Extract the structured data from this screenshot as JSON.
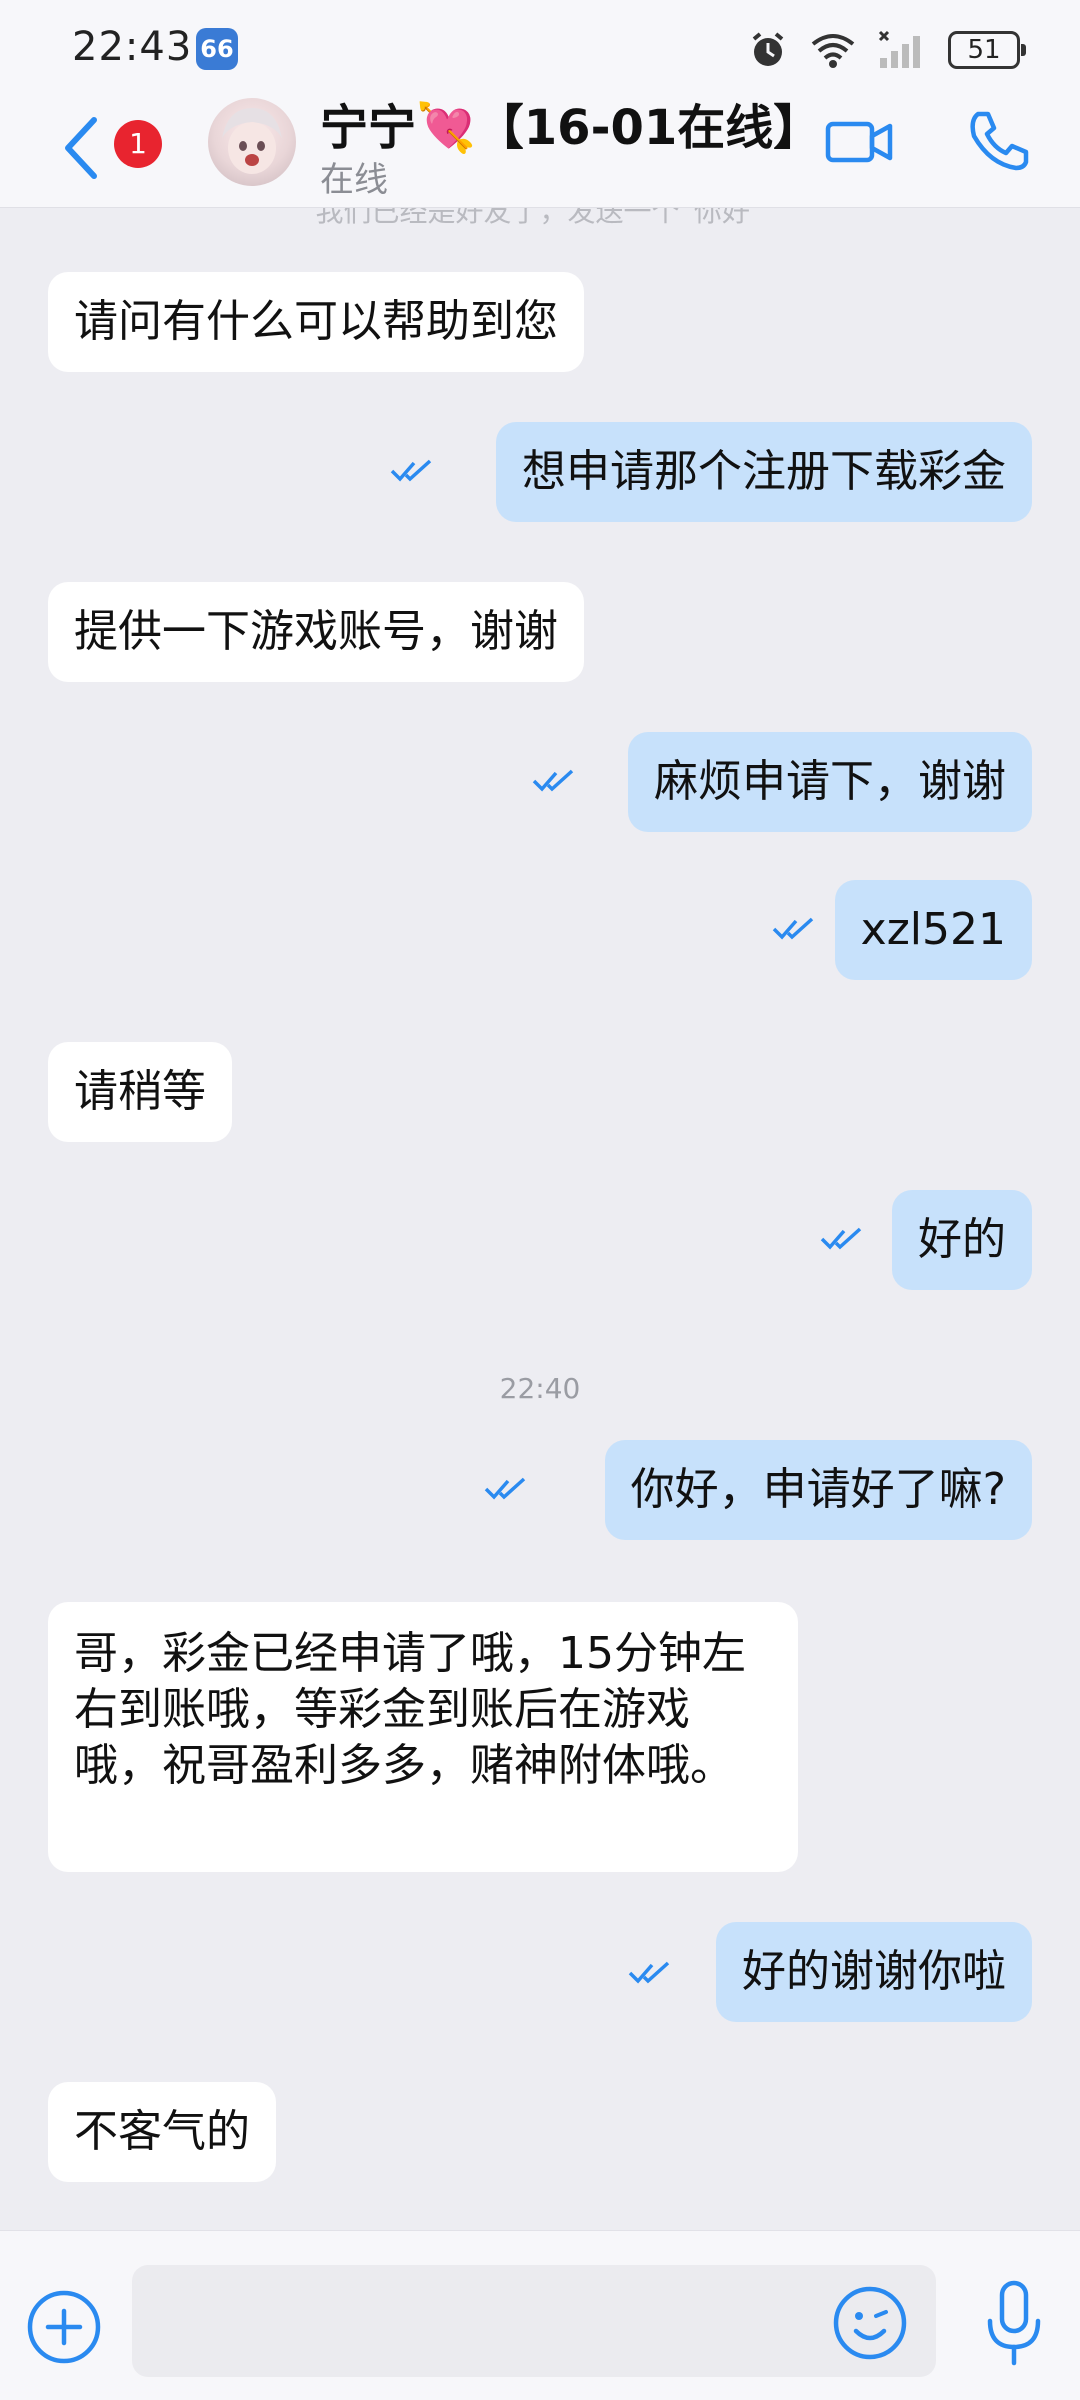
{
  "status_bar": {
    "time": "22:43",
    "app_badge": "66",
    "battery": "51"
  },
  "header": {
    "unread_count": "1",
    "contact_name": "宁宁💘【16-01在线】",
    "status": "在线"
  },
  "chat": {
    "faded_note": "我们已经是好友了，发送一个“你好”",
    "messages": [
      {
        "dir": "in",
        "text": "请问有什么可以帮助到您"
      },
      {
        "dir": "out",
        "text": "想申请那个注册下载彩金"
      },
      {
        "dir": "in",
        "text": "提供一下游戏账号，谢谢"
      },
      {
        "dir": "out",
        "text": "麻烦申请下，谢谢"
      },
      {
        "dir": "out",
        "text": "xzl521"
      },
      {
        "dir": "in",
        "text": "请稍等"
      },
      {
        "dir": "out",
        "text": "好的"
      },
      {
        "dir": "out",
        "text": "你好，申请好了嘛?"
      },
      {
        "dir": "in",
        "text": "哥，彩金已经申请了哦，15分钟左右到账哦，等彩金到账后在游戏哦，祝哥盈利多多，赌神附体哦。"
      },
      {
        "dir": "out",
        "text": "好的谢谢你啦"
      },
      {
        "dir": "in",
        "text": "不客气的"
      }
    ],
    "timestamp": "22:40"
  },
  "input": {
    "value": "",
    "placeholder": ""
  },
  "colors": {
    "accent": "#2a8af0",
    "out_bubble": "#c7e1fb",
    "in_bubble": "#ffffff",
    "background": "#ededf2",
    "unread_badge": "#e8242f"
  },
  "icons": [
    "back-arrow-icon",
    "video-call-icon",
    "phone-icon",
    "plus-icon",
    "emoji-icon",
    "microphone-icon",
    "double-check-icon",
    "wifi-icon",
    "signal-icon",
    "alarm-icon"
  ]
}
